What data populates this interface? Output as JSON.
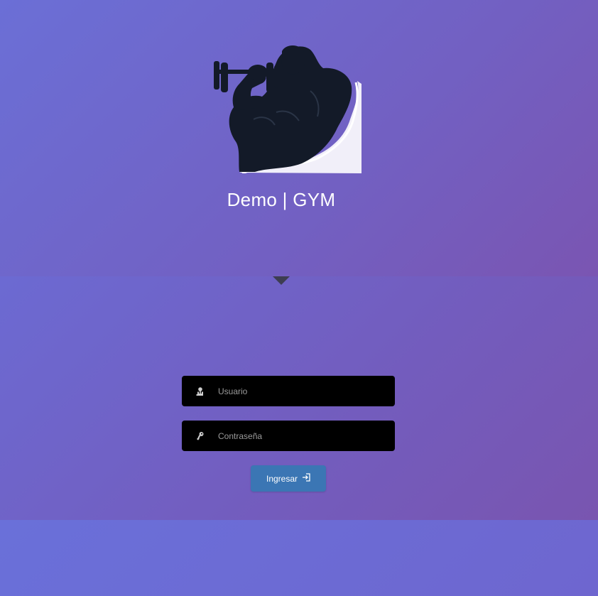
{
  "brand": {
    "title": "Demo | GYM",
    "logo_icon": "bodybuilder-dumbbell-icon"
  },
  "login": {
    "username": {
      "placeholder": "Usuario",
      "value": "",
      "icon": "user-icon"
    },
    "password": {
      "placeholder": "Contraseña",
      "value": "",
      "icon": "key-icon"
    },
    "submit": {
      "label": "Ingresar",
      "icon": "sign-in-icon"
    }
  },
  "colors": {
    "background_start": "#6a72d8",
    "background_end": "#7a56b0",
    "field_bg": "#000000",
    "button_bg": "#3b76b4",
    "logo_fill": "#131a28"
  }
}
